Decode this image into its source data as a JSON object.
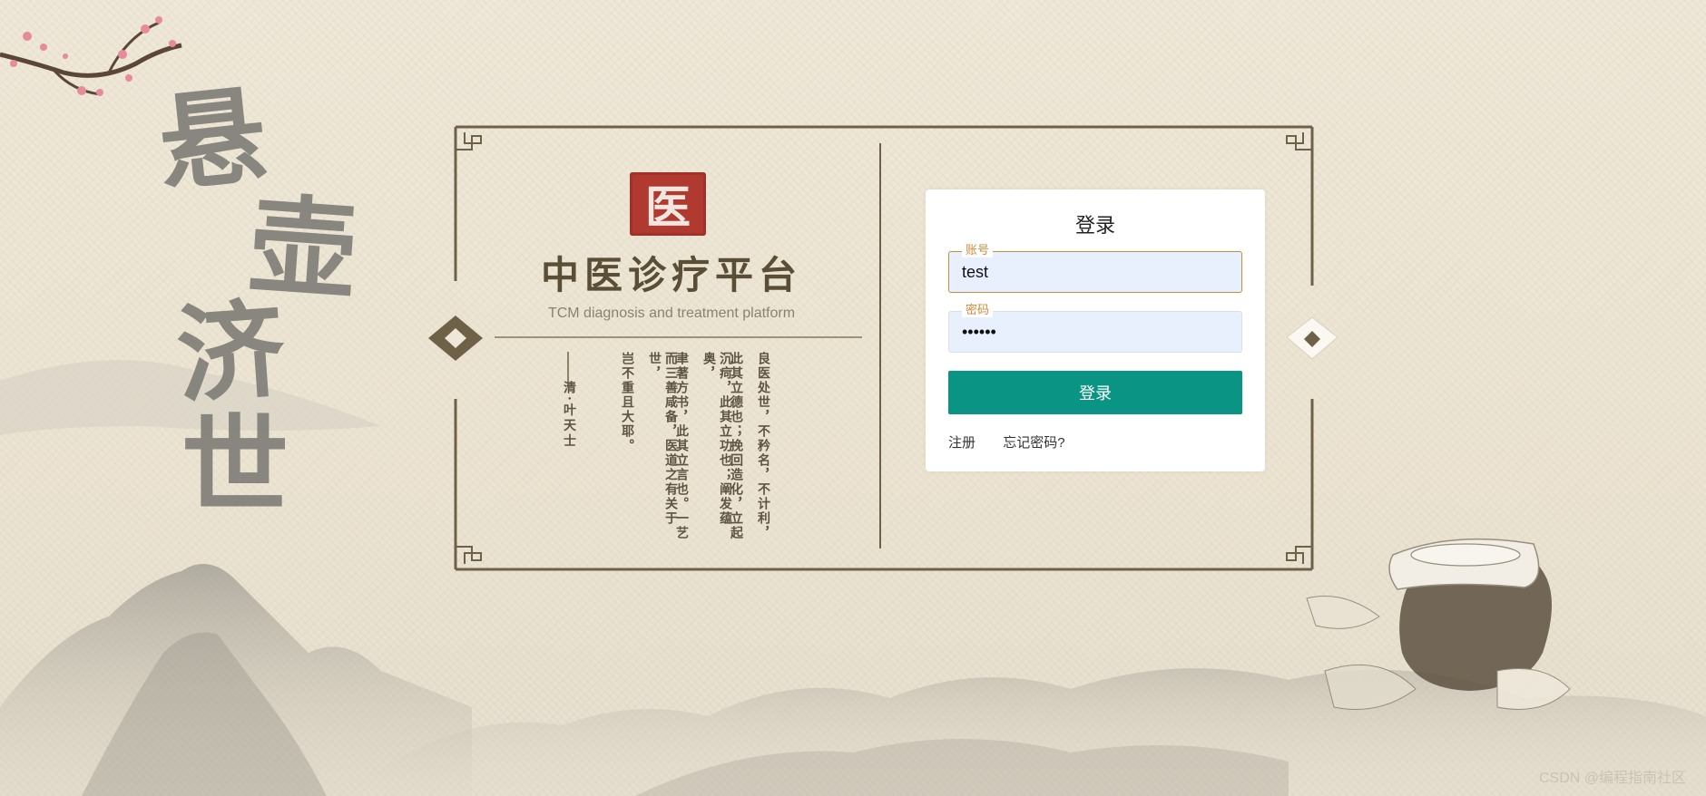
{
  "calligraphy": [
    "悬",
    "壶",
    "济",
    "世"
  ],
  "platform": {
    "seal_char": "医",
    "title": "中医诊疗平台",
    "subtitle": "TCM diagnosis and treatment platform",
    "poem_columns": [
      "良医处世，不矜名，不计利，",
      "此其立德也；挽回造化，立起",
      "沉疴，此其立功也；阐发蕴奥，",
      "聿著方书，此其立言也。一艺",
      "而三善咸备，医道之有关于世，",
      "岂不重且大耶。"
    ],
    "poem_author": "清·叶天士"
  },
  "login": {
    "title": "登录",
    "account_label": "账号",
    "account_value": "test",
    "password_label": "密码",
    "password_value": "••••••",
    "submit_label": "登录",
    "register_link": "注册",
    "forgot_link": "忘记密码?"
  },
  "watermark": "CSDN @编程指南社区"
}
